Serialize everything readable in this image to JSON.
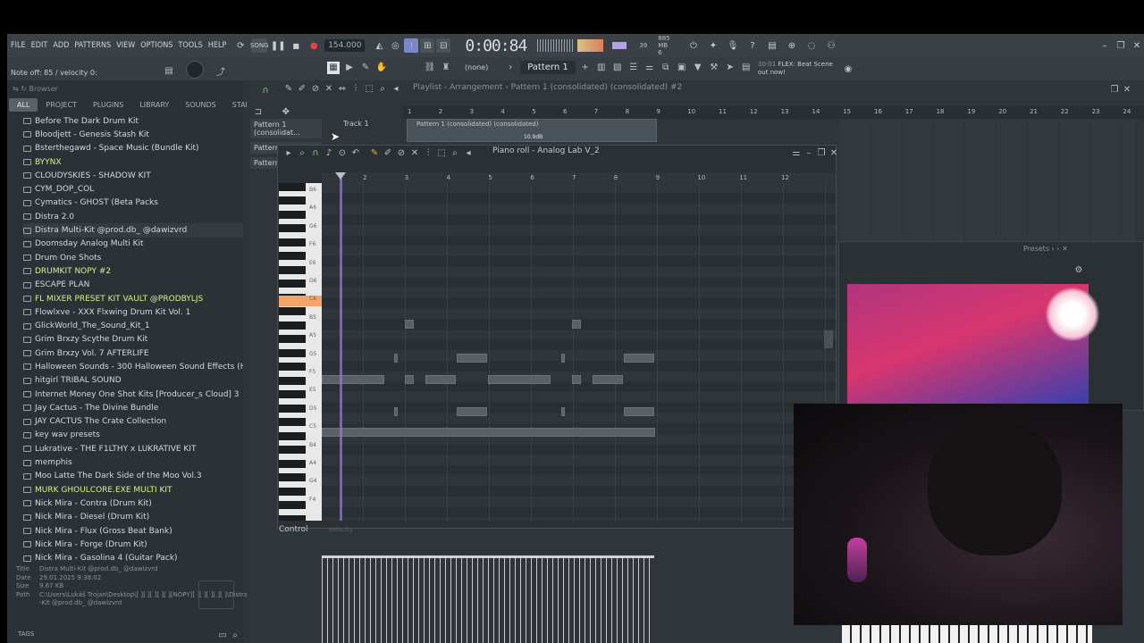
{
  "menu": [
    "FILE",
    "EDIT",
    "ADD",
    "PATTERNS",
    "VIEW",
    "OPTIONS",
    "TOOLS",
    "HELP"
  ],
  "transport": {
    "song_mode": "SONG",
    "tempo": "154.000",
    "timecode": "0:00:84",
    "cpu_label": "39",
    "memory_label": "885 MB",
    "memory_sub": "6"
  },
  "hint": "Note off: 85 / velocity 0:",
  "toolbar2": {
    "pattern_selector": "(none)",
    "pattern_name": "Pattern 1",
    "news_time": "30:01",
    "news_text": "FLEX: Beat Scene",
    "news_sub": "out now!"
  },
  "browser": {
    "title": "Browser",
    "tabs": [
      "ALL",
      "PROJECT",
      "PLUGINS",
      "LIBRARY",
      "SOUNDS",
      "STARRED"
    ],
    "active_tab": "ALL",
    "folders": [
      {
        "name": "Before The Dark Drum Kit",
        "hl": false
      },
      {
        "name": "Bloodjett - Genesis Stash Kit",
        "hl": false
      },
      {
        "name": "Bsterthegawd - Space Music (Bundle Kit)",
        "hl": false
      },
      {
        "name": "BYYNX",
        "hl": true
      },
      {
        "name": "CLOUDYSKIES - SHADOW KIT",
        "hl": false
      },
      {
        "name": "CYM_DOP_COL",
        "hl": false
      },
      {
        "name": "Cymatics - GHOST (Beta Packs",
        "hl": false
      },
      {
        "name": "Distra 2.0",
        "hl": false
      },
      {
        "name": "Distra Multi-Kit @prod.db_ @dawizvrd",
        "hl": false,
        "sel": true
      },
      {
        "name": "Doomsday Analog Multi Kit",
        "hl": false
      },
      {
        "name": "Drum One Shots",
        "hl": false
      },
      {
        "name": "DRUMKIT NOPY #2",
        "hl": true
      },
      {
        "name": "ESCAPE PLAN",
        "hl": false
      },
      {
        "name": "FL MIXER PRESET KIT VAULT @PRODBYLJS",
        "hl": true
      },
      {
        "name": "Flowlxve - XXX Flxwing Drum Kit Vol. 1",
        "hl": false
      },
      {
        "name": "GlickWorld_The_Sound_Kit_1",
        "hl": false
      },
      {
        "name": "Grim Brxzy Scythe Drum Kit",
        "hl": false
      },
      {
        "name": "Grim Brxzy Vol. 7 AFTERLIFE",
        "hl": false
      },
      {
        "name": "Halloween Sounds - 300 Halloween Sound Effects (Hot Ideas)",
        "hl": false
      },
      {
        "name": "hitgirl TRIBAL SOUND",
        "hl": false
      },
      {
        "name": "Internet Money One Shot Kits [Producer_s Cloud] 3",
        "hl": false
      },
      {
        "name": "Jay Cactus - The Divine Bundle",
        "hl": false
      },
      {
        "name": "JAY CACTUS The Crate Collection",
        "hl": false
      },
      {
        "name": "key wav presets",
        "hl": false
      },
      {
        "name": "Lukrative - THE F1LTHY x LUKRATIVE KIT",
        "hl": false
      },
      {
        "name": "memphis",
        "hl": false
      },
      {
        "name": "Moo Latte The Dark Side of the Moo Vol.3",
        "hl": false
      },
      {
        "name": "MURK GHOULCORE.EXE MULTI KIT",
        "hl": true
      },
      {
        "name": "Nick Mira - Contra (Drum Kit)",
        "hl": false
      },
      {
        "name": "Nick Mira - Diesel (Drum Kit)",
        "hl": false
      },
      {
        "name": "Nick Mira - Flux (Gross Beat Bank)",
        "hl": false
      },
      {
        "name": "Nick Mira - Forge (Drum Kit)",
        "hl": false
      },
      {
        "name": "Nick Mira - Gasolina 4 (Guitar Pack)",
        "hl": false
      }
    ],
    "info": {
      "title_label": "Title",
      "title": "Distra Multi-Kit @prod.db_ @dawizvrd",
      "date_label": "Date",
      "date": "29.01.2025 9:38:02",
      "size_label": "Size",
      "size": "9.67 KB",
      "path_label": "Path",
      "path": "C:\\Users\\Lukáš Trojan\\Desktop\\[ ][ ][ ][ ][ ][NOPY][ ][ ][ ][ ][ ]\\Distra Multi-",
      "path2": "-Kit @prod.db_ @dawizvrd"
    },
    "tags_label": "TAGS"
  },
  "playlist": {
    "title": "Playlist - Arrangement › Pattern 1 (consolidated) (consolidated) #2",
    "pattern_btn": "Pattern 1 (consolidat...",
    "pattern_btn2": "Pattern",
    "pattern_btn3": "Pattern",
    "track": "Track 1",
    "clip_label": "Pattern 1 (consolidated) (consolidated)",
    "clip_db": "10.9dB",
    "bars": [
      "1",
      "2",
      "3",
      "4",
      "5",
      "6",
      "7",
      "8",
      "9",
      "10",
      "11",
      "12",
      "13",
      "14",
      "15",
      "16",
      "17",
      "18",
      "19",
      "20",
      "21",
      "22",
      "23",
      "24"
    ]
  },
  "pianoroll": {
    "title": "Piano roll - Analog Lab V_2",
    "bars": [
      "2",
      "3",
      "4",
      "5",
      "6",
      "7",
      "8",
      "9",
      "10",
      "11",
      "12"
    ],
    "octave_labels": [
      "B6",
      "A6",
      "G6",
      "F6",
      "E6",
      "D6",
      "C6",
      "B5",
      "A5",
      "G5",
      "F5",
      "E5",
      "D5",
      "C5",
      "B4",
      "A4",
      "G4",
      "F4"
    ],
    "control_label": "Control",
    "control_sub": "Velocity"
  },
  "presets": {
    "title": "Presets"
  }
}
